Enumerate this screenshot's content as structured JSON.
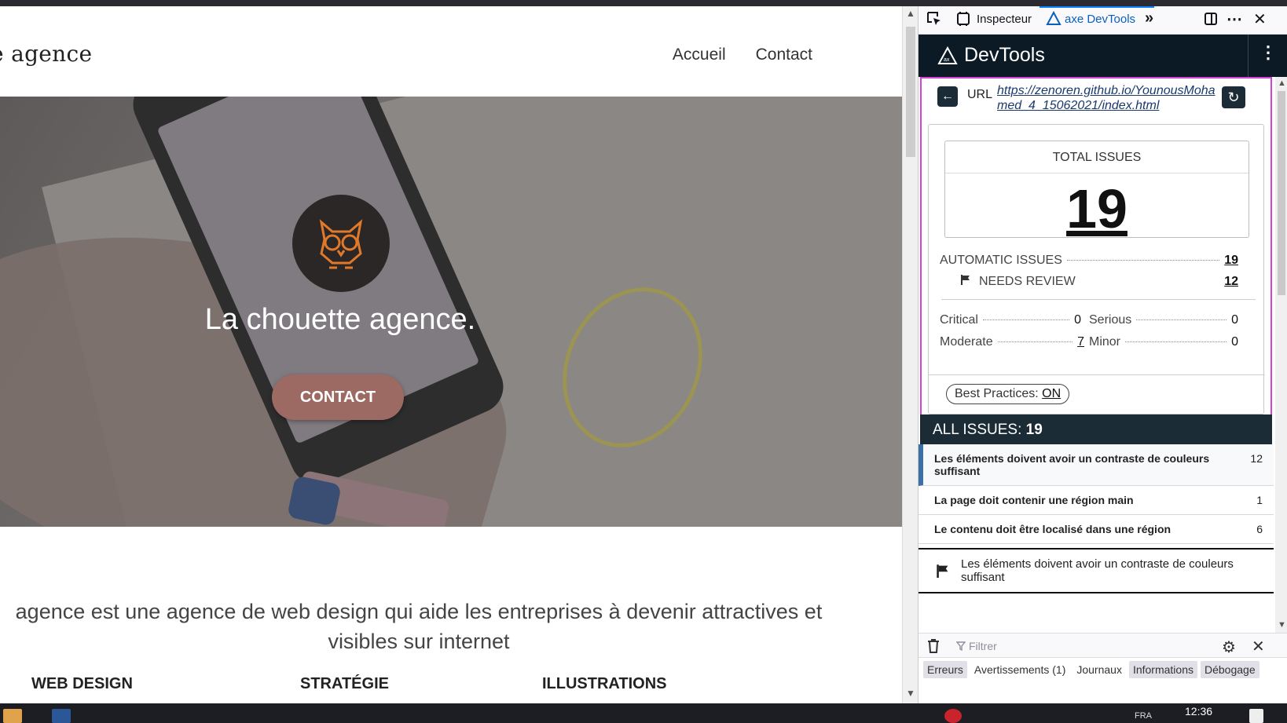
{
  "site": {
    "logo": "e agence",
    "nav": [
      "Accueil",
      "Contact"
    ],
    "hero_title": "La chouette agence.",
    "hero_cta": "CONTACT",
    "about_line1": "agence est une agence de web design qui aide les entreprises à devenir attractives et",
    "about_line2": "visibles sur internet",
    "services": [
      "WEB DESIGN",
      "STRATÉGIE",
      "ILLUSTRATIONS"
    ]
  },
  "devtools": {
    "toolbar": {
      "inspector": "Inspecteur",
      "axe_tab": "axe DevTools"
    },
    "header_brand": "DevTools",
    "url_label": "URL",
    "url_line1": "https://zenoren.github.io/YounousMoha",
    "url_line2": "med_4_15062021/index.html",
    "total_label": "TOTAL ISSUES",
    "total_value": "19",
    "automatic_label": "AUTOMATIC ISSUES",
    "automatic_value": "19",
    "needs_review_label": "NEEDS REVIEW",
    "needs_review_value": "12",
    "critical_label": "Critical",
    "critical_value": "0",
    "serious_label": "Serious",
    "serious_value": "0",
    "moderate_label": "Moderate",
    "moderate_value": "7",
    "minor_label": "Minor",
    "minor_value": "0",
    "best_practices_label": "Best Practices:",
    "best_practices_state": "ON",
    "all_issues_label": "ALL ISSUES:",
    "all_issues_count": "19",
    "issues": [
      {
        "label": "Les éléments doivent avoir un contraste de couleurs suffisant",
        "count": "12"
      },
      {
        "label": "La page doit contenir une région main",
        "count": "1"
      },
      {
        "label": "Le contenu doit être localisé dans une région",
        "count": "6"
      }
    ],
    "detail_text": "Les éléments doivent avoir un contraste de couleurs suffisant",
    "console": {
      "filter_placeholder": "Filtrer",
      "categories": [
        "Erreurs",
        "Avertissements (1)",
        "Journaux",
        "Informations",
        "Débogage"
      ]
    }
  },
  "taskbar": {
    "lang": "FRA",
    "clock": "12:36"
  },
  "colors": {
    "axe_dark": "#0b1a24",
    "focus_outline": "#d642d8",
    "accent_blue": "#0a84ff",
    "cta": "#9d6a63"
  }
}
